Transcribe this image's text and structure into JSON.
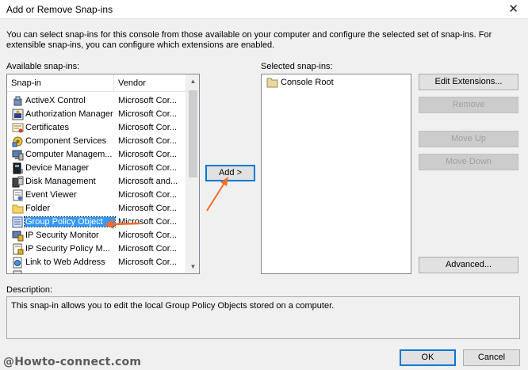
{
  "window": {
    "title": "Add or Remove Snap-ins"
  },
  "intro_text": "You can select snap-ins for this console from those available on your computer and configure the selected set of snap-ins. For extensible snap-ins, you can configure which extensions are enabled.",
  "available": {
    "label": "Available snap-ins:",
    "columns": {
      "snapin": "Snap-in",
      "vendor": "Vendor"
    },
    "rows": [
      {
        "name": "ActiveX Control",
        "vendor": "Microsoft Cor...",
        "icon": "activex-icon"
      },
      {
        "name": "Authorization Manager",
        "vendor": "Microsoft Cor...",
        "icon": "authorization-icon"
      },
      {
        "name": "Certificates",
        "vendor": "Microsoft Cor...",
        "icon": "certificate-icon"
      },
      {
        "name": "Component Services",
        "vendor": "Microsoft Cor...",
        "icon": "component-services-icon"
      },
      {
        "name": "Computer Managem...",
        "vendor": "Microsoft Cor...",
        "icon": "computer-management-icon"
      },
      {
        "name": "Device Manager",
        "vendor": "Microsoft Cor...",
        "icon": "device-manager-icon"
      },
      {
        "name": "Disk Management",
        "vendor": "Microsoft and...",
        "icon": "disk-management-icon"
      },
      {
        "name": "Event Viewer",
        "vendor": "Microsoft Cor...",
        "icon": "event-viewer-icon"
      },
      {
        "name": "Folder",
        "vendor": "Microsoft Cor...",
        "icon": "folder-icon"
      },
      {
        "name": "Group Policy Object ...",
        "vendor": "Microsoft Cor...",
        "icon": "group-policy-icon",
        "selected": true
      },
      {
        "name": "IP Security Monitor",
        "vendor": "Microsoft Cor...",
        "icon": "ip-security-icon"
      },
      {
        "name": "IP Security Policy M...",
        "vendor": "Microsoft Cor...",
        "icon": "ip-security-policy-icon"
      },
      {
        "name": "Link to Web Address",
        "vendor": "Microsoft Cor...",
        "icon": "web-link-icon"
      }
    ]
  },
  "add_button": "Add >",
  "selected": {
    "label": "Selected snap-ins:",
    "items": [
      {
        "name": "Console Root",
        "icon": "folder-icon"
      }
    ]
  },
  "side_buttons": {
    "edit_extensions": "Edit Extensions...",
    "remove": "Remove",
    "move_up": "Move Up",
    "move_down": "Move Down",
    "advanced": "Advanced..."
  },
  "description": {
    "label": "Description:",
    "text": "This snap-in allows you to edit the local Group Policy Objects stored on a computer."
  },
  "footer": {
    "ok": "OK",
    "cancel": "Cancel"
  },
  "watermark": "@Howto-connect.com",
  "colors": {
    "selection": "#3399ff",
    "annotation_arrow": "#f26b2a",
    "focus_border": "#0078d7"
  }
}
